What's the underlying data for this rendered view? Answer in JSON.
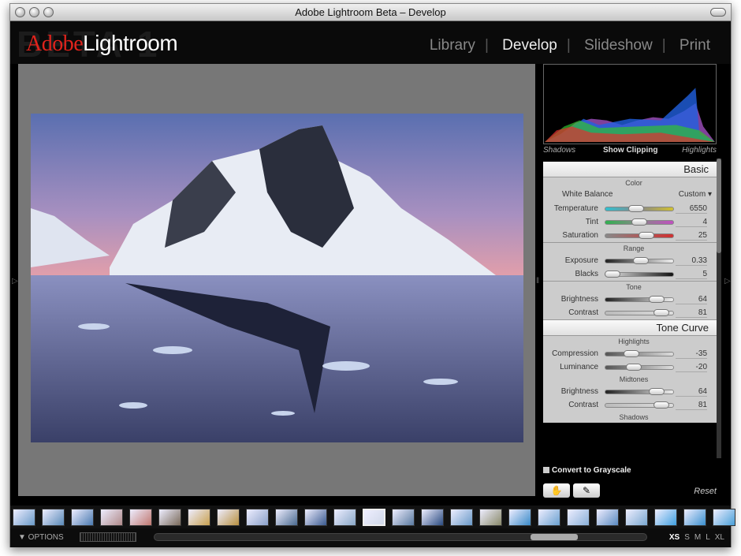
{
  "window": {
    "title": "Adobe Lightroom Beta – Develop"
  },
  "header": {
    "logo_adobe": "Adobe",
    "logo_lightroom": "Lightroom",
    "beta_watermark": "BETA 1",
    "modules": [
      {
        "label": "Library",
        "active": false
      },
      {
        "label": "Develop",
        "active": true
      },
      {
        "label": "Slideshow",
        "active": false
      },
      {
        "label": "Print",
        "active": false
      }
    ]
  },
  "histogram": {
    "shadows": "Shadows",
    "clipping": "Show Clipping",
    "highlights": "Highlights"
  },
  "basic": {
    "title": "Basic",
    "color": {
      "title": "Color",
      "wb_label": "White Balance",
      "wb_value": "Custom ▾",
      "rows": [
        {
          "label": "Temperature",
          "value": "6550",
          "pos": 0.45
        },
        {
          "label": "Tint",
          "value": "4",
          "pos": 0.5
        },
        {
          "label": "Saturation",
          "value": "25",
          "pos": 0.6
        }
      ]
    },
    "range": {
      "title": "Range",
      "rows": [
        {
          "label": "Exposure",
          "value": "0.33",
          "pos": 0.52
        },
        {
          "label": "Blacks",
          "value": "5",
          "pos": 0.1
        }
      ]
    },
    "tone": {
      "title": "Tone",
      "rows": [
        {
          "label": "Brightness",
          "value": "64",
          "pos": 0.75
        },
        {
          "label": "Contrast",
          "value": "81",
          "pos": 0.82
        }
      ]
    }
  },
  "tone_curve": {
    "title": "Tone Curve",
    "highlights": "Highlights",
    "midtones": "Midtones",
    "shadows": "Shadows",
    "hrows": [
      {
        "label": "Compression",
        "value": "-35",
        "pos": 0.38
      },
      {
        "label": "Luminance",
        "value": "-20",
        "pos": 0.42
      }
    ],
    "mrows": [
      {
        "label": "Brightness",
        "value": "64",
        "pos": 0.75
      },
      {
        "label": "Contrast",
        "value": "81",
        "pos": 0.82
      }
    ]
  },
  "convert_grayscale": "Convert to Grayscale",
  "reset": "Reset",
  "bottom": {
    "options": "▼ OPTIONS",
    "sizes": [
      "XS",
      "S",
      "M",
      "L",
      "XL"
    ],
    "active_size": "XS"
  },
  "filmstrip": {
    "thumb_colors": [
      "#6a9ac8",
      "#5a8ab8",
      "#4a7ab0",
      "#b08a8a",
      "#c07870",
      "#7a6a5a",
      "#c8a050",
      "#b89040",
      "#8aa0c8",
      "#4a6a90",
      "#3a5a90",
      "#8aa8c8",
      "#d0d8e8",
      "#5a7aa0",
      "#2a4a80",
      "#6a9ac8",
      "#8a8a6a",
      "#3a8ac8",
      "#6aa0d0",
      "#8ab0d8",
      "#5a8ac0",
      "#7aa8d0",
      "#40a0e0",
      "#3a90d0",
      "#4aa0d8"
    ]
  }
}
